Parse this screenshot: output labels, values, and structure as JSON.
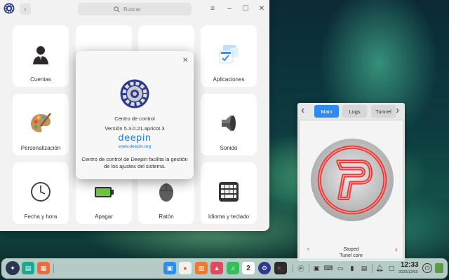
{
  "control_center": {
    "search_placeholder": "Buscar",
    "tiles": [
      {
        "label": "Cuentas",
        "icon": "user-account-icon"
      },
      {
        "label": "",
        "icon": "network-icon"
      },
      {
        "label": "",
        "icon": "display-icon"
      },
      {
        "label": "Aplicaciones",
        "icon": "applications-icon"
      },
      {
        "label": "Personalización",
        "icon": "palette-icon"
      },
      {
        "label": "",
        "icon": "notification-icon"
      },
      {
        "label": "",
        "icon": "sound-icon-partial"
      },
      {
        "label": "Sonido",
        "icon": "speaker-icon"
      },
      {
        "label": "Fecha y hora",
        "icon": "clock-icon"
      },
      {
        "label": "Apagar",
        "icon": "battery-icon"
      },
      {
        "label": "Ratón",
        "icon": "mouse-icon"
      },
      {
        "label": "Idioma y teclado",
        "icon": "keyboard-icon"
      }
    ]
  },
  "about_dialog": {
    "app_name": "Centro de control",
    "version": "Versión 5.3.0.21.apricot.3",
    "brand": "deepin",
    "website": "www.deepin.org",
    "description": "Centro de control de Deepin facilita la gestión de los ajustes del sistema."
  },
  "psiphon": {
    "tabs": [
      "Main",
      "Logs",
      "Tunnel"
    ],
    "active_tab": "Main",
    "status_line1": "Stoped",
    "status_line2": "Tunel core",
    "help_mark": "?",
    "close_mark": "x",
    "accent": "#2e8cf0"
  },
  "taskbar": {
    "time": "12:33",
    "date": "2020/12/02",
    "calendar_day": "2"
  }
}
